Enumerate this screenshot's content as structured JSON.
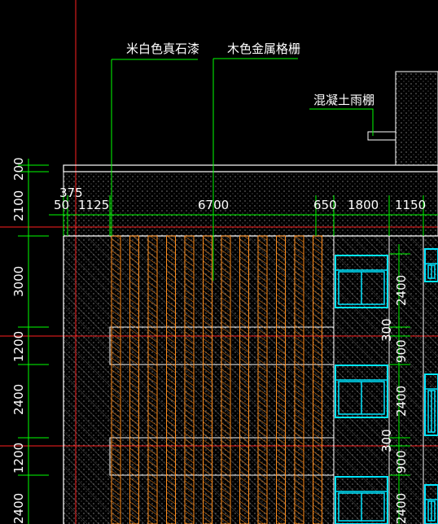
{
  "labels": {
    "stone_paint": "米白色真石漆",
    "metal_grille": "木色金属格栅",
    "concrete_canopy": "混凝土雨棚"
  },
  "horizontal_dims": [
    "375",
    "50",
    "1125",
    "6700",
    "650",
    "1800",
    "1150"
  ],
  "vertical_dims_left": [
    "200",
    "2100",
    "3000",
    "1200",
    "2400",
    "1200",
    "2400"
  ],
  "vertical_dims_right": [
    "2400",
    "300",
    "900",
    "2400",
    "300",
    "900",
    "2400"
  ],
  "colors": {
    "background": "#000000",
    "dimension_line": "#00ff00",
    "axis_line": "#ff0000",
    "grille": "#ff8c1a",
    "window": "#00e5ff",
    "wall_outline": "#ffffff",
    "hatch": "#9a9a9a"
  }
}
